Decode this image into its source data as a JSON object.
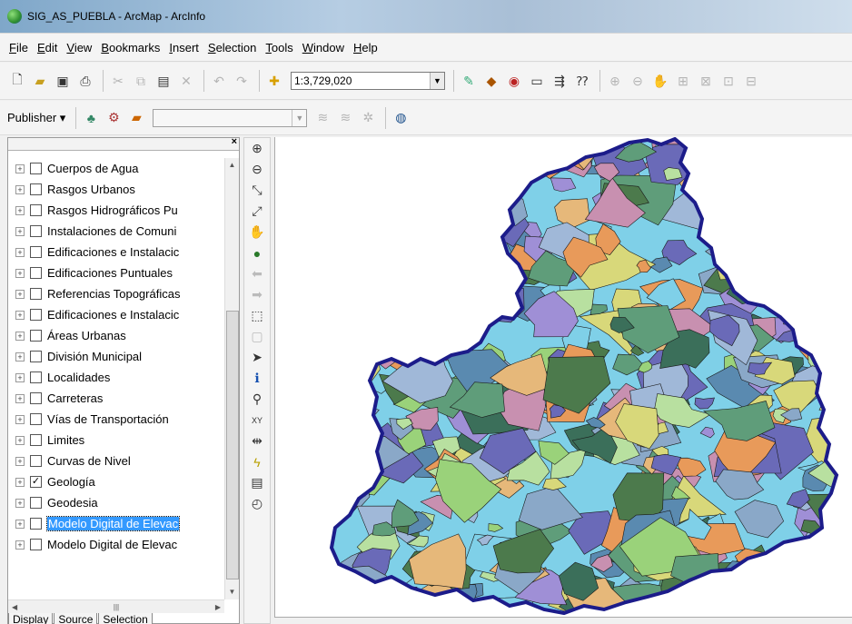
{
  "window": {
    "title": "SIG_AS_PUEBLA - ArcMap - ArcInfo"
  },
  "menu": [
    "File",
    "Edit",
    "View",
    "Bookmarks",
    "Insert",
    "Selection",
    "Tools",
    "Window",
    "Help"
  ],
  "toolbar": {
    "scale_value": "1:3,729,020",
    "publisher_label": "Publisher ▾"
  },
  "toc": {
    "layers": [
      {
        "name": "Cuerpos de Agua",
        "checked": false
      },
      {
        "name": "Rasgos Urbanos",
        "checked": false
      },
      {
        "name": "Rasgos Hidrográficos Pu",
        "checked": false
      },
      {
        "name": "Instalaciones de Comuni",
        "checked": false
      },
      {
        "name": "Edificaciones e Instalacic",
        "checked": false
      },
      {
        "name": "Edificaciones Puntuales",
        "checked": false
      },
      {
        "name": "Referencias Topográficas",
        "checked": false
      },
      {
        "name": "Edificaciones e Instalacic",
        "checked": false
      },
      {
        "name": "Áreas Urbanas",
        "checked": false
      },
      {
        "name": "División Municipal",
        "checked": false
      },
      {
        "name": "Localidades",
        "checked": false
      },
      {
        "name": "Carreteras",
        "checked": false
      },
      {
        "name": "Vías de Transportación",
        "checked": false
      },
      {
        "name": "Limites",
        "checked": false
      },
      {
        "name": "Curvas de Nivel",
        "checked": false
      },
      {
        "name": "Geología",
        "checked": true
      },
      {
        "name": "Geodesia",
        "checked": false
      },
      {
        "name": "Modelo Digital de Elevac",
        "checked": false,
        "selected": true
      },
      {
        "name": "Modelo Digital de Elevac",
        "checked": false
      }
    ],
    "tabs": [
      "Display",
      "Source",
      "Selection"
    ],
    "expander_symbol": "+",
    "check_symbol": "✓"
  },
  "icons": {
    "new": "new-document-icon",
    "open": "open-folder-icon",
    "save": "save-icon",
    "print": "print-icon",
    "zoom_in": "zoom-in-icon",
    "zoom_out": "zoom-out-icon",
    "pan": "pan-hand-icon",
    "globe": "full-extent-globe-icon",
    "identify": "identify-icon",
    "find": "find-binoculars-icon",
    "xy": "go-to-xy-icon",
    "measure": "measure-icon",
    "hyperlink": "hyperlink-lightning-icon",
    "html_popup": "html-popup-icon",
    "select": "select-arrow-icon"
  },
  "map_colors": {
    "boundary": "#1c1c8a",
    "units": [
      "#7fd0e8",
      "#5f9d7a",
      "#9ad27a",
      "#6a6ab8",
      "#e89a5a",
      "#d8d87a",
      "#4c7a4c",
      "#a0b8d8",
      "#b8e0a0",
      "#8aa8c8",
      "#5a8ab0",
      "#c890b0",
      "#3b6f5a",
      "#e6b87a",
      "#9f8fd6"
    ]
  }
}
